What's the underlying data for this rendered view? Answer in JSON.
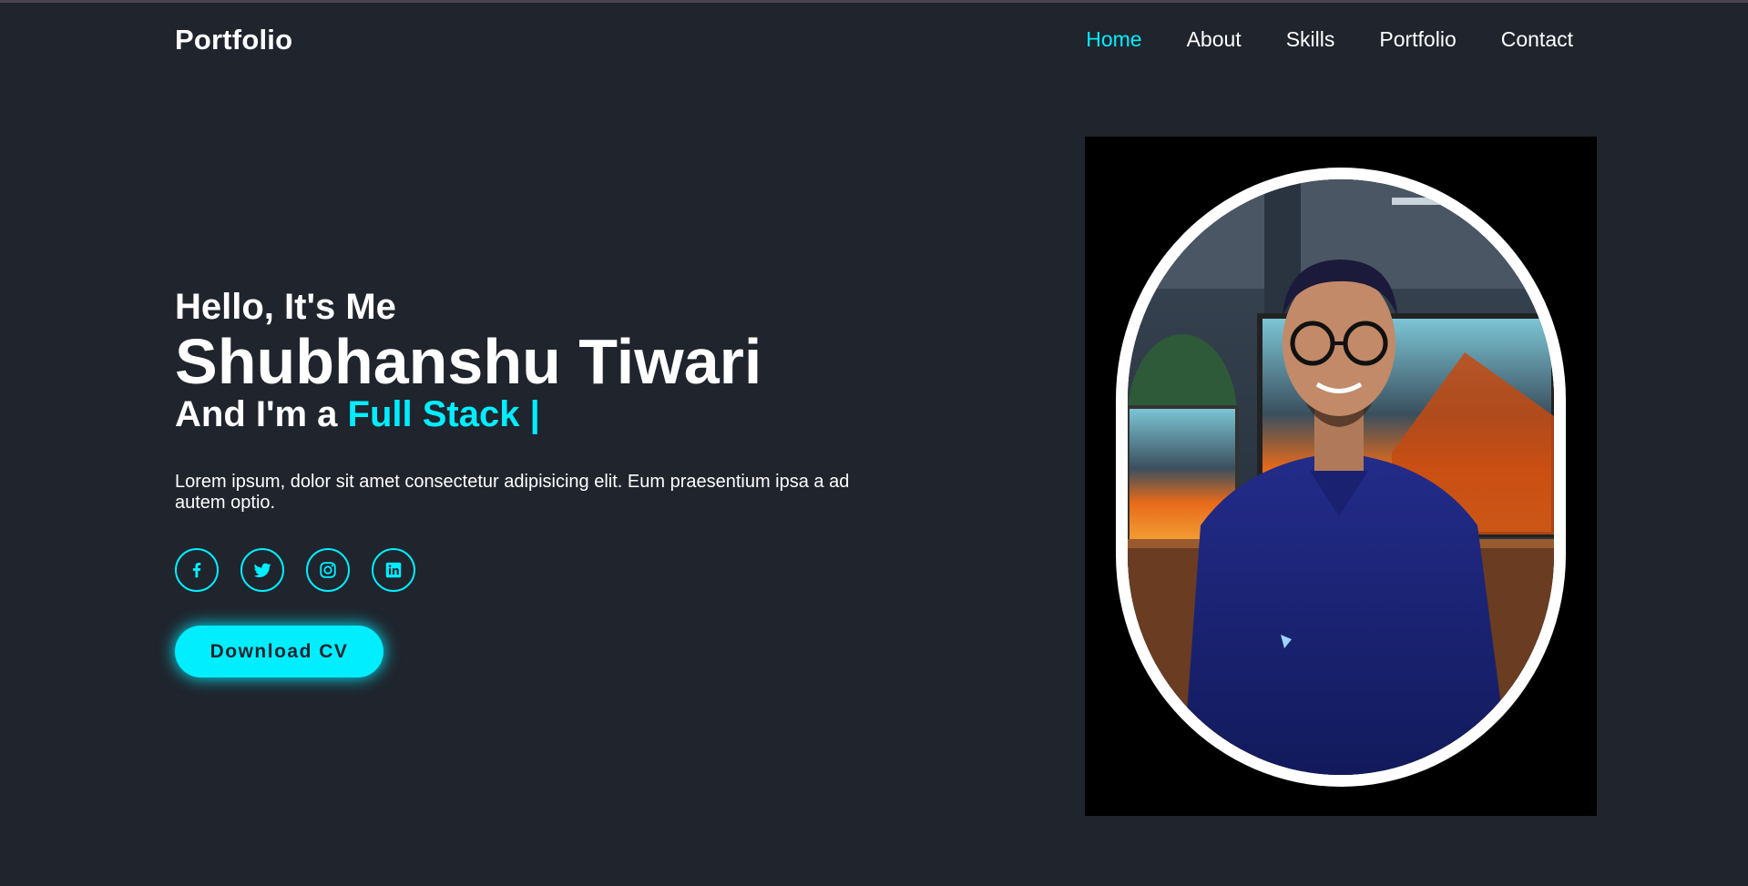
{
  "header": {
    "logo": "Portfolio",
    "nav": [
      "Home",
      "About",
      "Skills",
      "Portfolio",
      "Contact"
    ],
    "active": "Home"
  },
  "hero": {
    "greeting": "Hello, It's Me",
    "name": "Shubhanshu Tiwari",
    "role_prefix": "And I'm a",
    "role_typed": "Full Stack |",
    "description": "Lorem ipsum, dolor sit amet consectetur adipisicing elit. Eum praesentium ipsa a ad autem optio.",
    "socials": [
      "facebook-icon",
      "twitter-icon",
      "instagram-icon",
      "linkedin-icon"
    ],
    "button": "Download CV"
  },
  "colors": {
    "background": "#1f242d",
    "accent": "#00eeff",
    "text": "#ffffff"
  }
}
